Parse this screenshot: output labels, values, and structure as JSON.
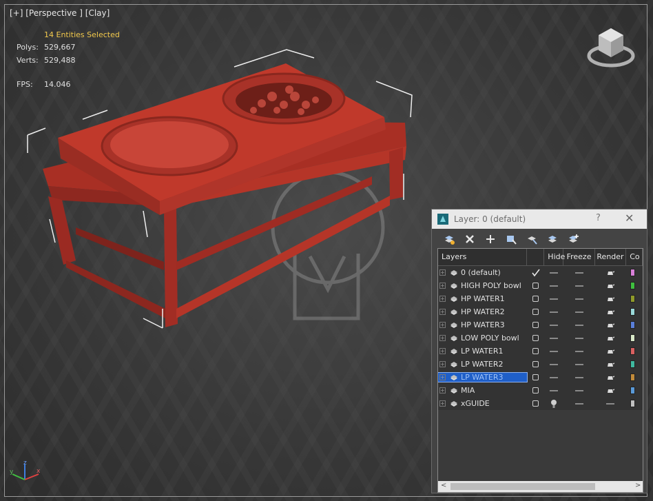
{
  "viewport": {
    "label_parts": [
      "[+]",
      "[Perspective ]",
      "[Clay]"
    ],
    "stats": {
      "selection": "14 Entities Selected",
      "polys_label": "Polys:",
      "polys_value": "529,667",
      "verts_label": "Verts:",
      "verts_value": "529,488",
      "fps_label": "FPS:",
      "fps_value": "14.046"
    },
    "stats_color": "#f2c94c",
    "object_color": "#c0392b"
  },
  "axis": {
    "z": "z",
    "x": "x",
    "y": "y"
  },
  "layer_dialog": {
    "title": "Layer: 0 (default)",
    "help": "?",
    "close": "✕",
    "toolbar_icons": [
      "create-layer-icon",
      "delete-layer-icon",
      "add-to-layer-icon",
      "select-objects-icon",
      "highlight-layer-icon",
      "hide-all-icon",
      "freeze-all-icon"
    ],
    "columns": {
      "layers": "Layers",
      "hide": "Hide",
      "freeze": "Freeze",
      "render": "Render",
      "color": "Co"
    },
    "layers": [
      {
        "name": "0 (default)",
        "current": true,
        "hidden": false,
        "color": "#d980d9"
      },
      {
        "name": "HIGH POLY bowl",
        "current": false,
        "hidden": false,
        "color": "#3fbf3f"
      },
      {
        "name": "HP WATER1",
        "current": false,
        "hidden": false,
        "color": "#8f9a2a"
      },
      {
        "name": "HP WATER2",
        "current": false,
        "hidden": false,
        "color": "#9adada"
      },
      {
        "name": "HP WATER3",
        "current": false,
        "hidden": false,
        "color": "#5a7fd8"
      },
      {
        "name": "LOW POLY bowl",
        "current": false,
        "hidden": false,
        "color": "#d8e8c8"
      },
      {
        "name": "LP WATER1",
        "current": false,
        "hidden": false,
        "color": "#d96060"
      },
      {
        "name": "LP WATER2",
        "current": false,
        "hidden": false,
        "color": "#3fb9a0"
      },
      {
        "name": "LP WATER3",
        "current": false,
        "hidden": false,
        "color": "#c08a3a",
        "selected": true
      },
      {
        "name": "MIA",
        "current": false,
        "hidden": false,
        "color": "#5a9ad8"
      },
      {
        "name": "xGUIDE",
        "current": false,
        "hidden": true,
        "color": "#c0c0c0"
      }
    ]
  }
}
